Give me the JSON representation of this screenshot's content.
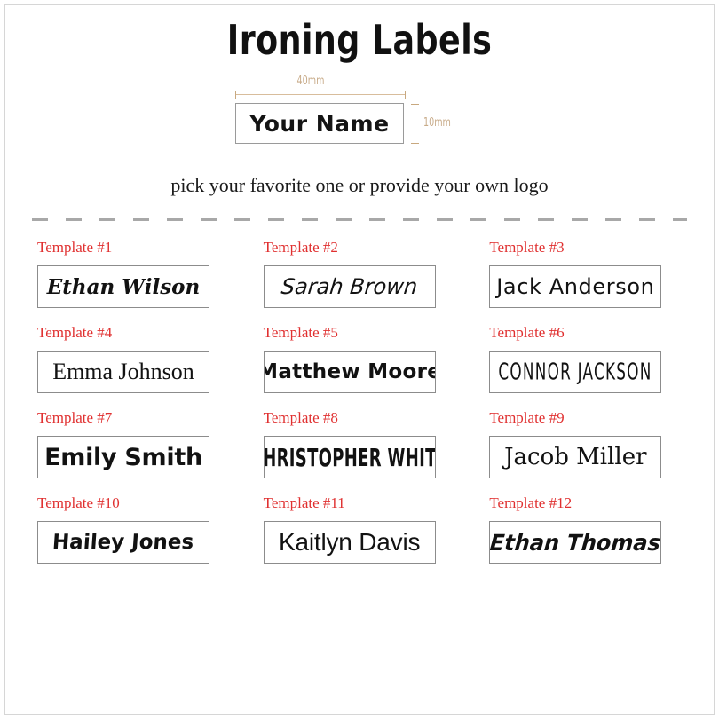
{
  "page": {
    "title": "Ironing Labels",
    "subtitle": "pick your favorite one or provide your own logo",
    "border_color": "#d6d6d6",
    "background": "#ffffff"
  },
  "sample": {
    "name_text": "Your Name",
    "width_label": "40mm",
    "height_label": "10mm",
    "dimension_color": "#c8ab89",
    "box_border_color": "#9a9a9a"
  },
  "divider": {
    "style": "dashed",
    "color": "#a8a8a8"
  },
  "templates": {
    "label_color": "#e03030",
    "box_border_color": "#8c8c8c",
    "items": [
      {
        "label": "Template #1",
        "name": "Ethan Wilson"
      },
      {
        "label": "Template #2",
        "name": "Sarah Brown"
      },
      {
        "label": "Template #3",
        "name": "Jack Anderson"
      },
      {
        "label": "Template #4",
        "name": "Emma Johnson"
      },
      {
        "label": "Template #5",
        "name": "Matthew Moore"
      },
      {
        "label": "Template #6",
        "name": "CONNOR JACKSON"
      },
      {
        "label": "Template #7",
        "name": "Emily Smith"
      },
      {
        "label": "Template #8",
        "name": "CHRISTOPHER WHITE"
      },
      {
        "label": "Template #9",
        "name": "Jacob Miller"
      },
      {
        "label": "Template #10",
        "name": "Hailey Jones"
      },
      {
        "label": "Template #11",
        "name": "Kaitlyn Davis"
      },
      {
        "label": "Template #12",
        "name": "Ethan Thomas"
      }
    ]
  }
}
